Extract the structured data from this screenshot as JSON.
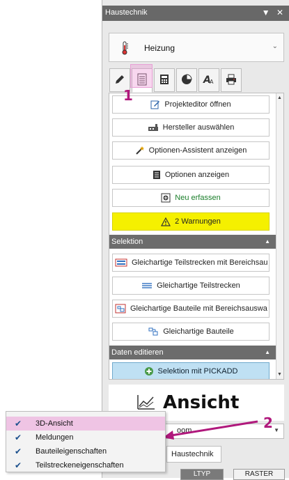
{
  "window": {
    "title": "Haustechnik",
    "controls": "▼ ✕"
  },
  "system_select": {
    "value": "Heizung"
  },
  "annotations": {
    "one": "1",
    "two": "2"
  },
  "buttons": {
    "projekteditor": "Projekteditor öffnen",
    "hersteller": "Hersteller auswählen",
    "optionen_assistent": "Optionen-Assistent anzeigen",
    "optionen": "Optionen anzeigen",
    "neu": "Neu erfassen",
    "warnungen": "2 Warnungen",
    "teilstrecken_bereich": "Gleichartige Teilstrecken mit Bereichsau",
    "teilstrecken": "Gleichartige Teilstrecken",
    "bauteile_bereich": "Gleichartige Bauteile mit Bereichsauswa",
    "bauteile": "Gleichartige Bauteile",
    "pickadd": "Selektion mit PICKADD"
  },
  "sections": {
    "selektion": "Selektion",
    "daten_editieren": "Daten editieren"
  },
  "ansicht": {
    "label": "Ansicht"
  },
  "combo": {
    "value": "oom"
  },
  "bottom_tabs": {
    "haustechnik": "Haustechnik"
  },
  "footer": {
    "ltyp": "LTYP",
    "raster": "RASTER"
  },
  "context_menu": {
    "items": [
      {
        "label": "3D-Ansicht",
        "checked": true
      },
      {
        "label": "Meldungen",
        "checked": true
      },
      {
        "label": "Bauteileigenschaften",
        "checked": true
      },
      {
        "label": "Teilstreckeneigenschaften",
        "checked": true
      }
    ]
  },
  "colors": {
    "annotation": "#b0187c",
    "warning": "#f5f000",
    "selection": "#bfe0f3"
  }
}
